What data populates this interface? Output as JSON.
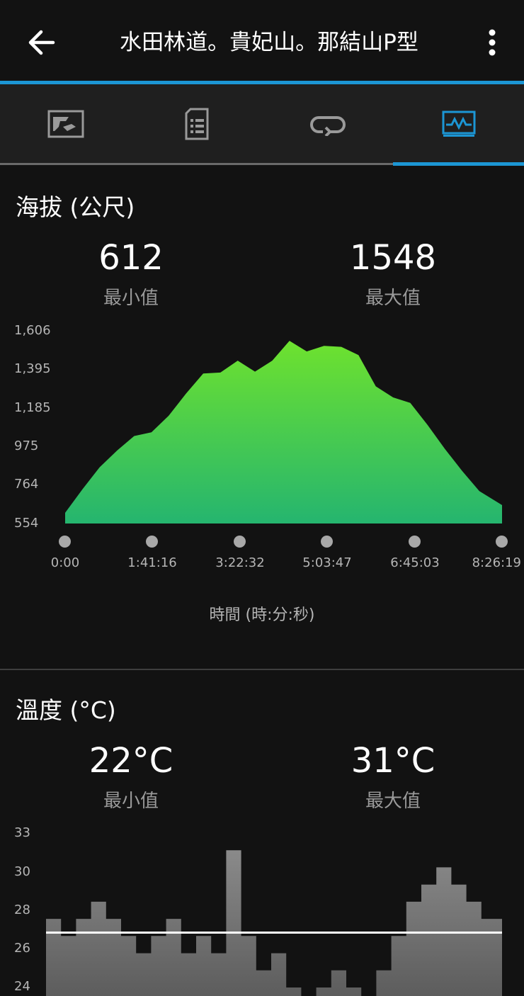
{
  "header": {
    "title": "水田林道。貴妃山。那結山P型"
  },
  "icons": {
    "back": "arrow-left-icon",
    "more": "more-vertical-icon",
    "tabs": [
      "map-icon",
      "details-icon",
      "laps-icon",
      "charts-icon"
    ]
  },
  "colors": {
    "accent": "#1c96d4",
    "elevation_top": "#6ee22e",
    "elevation_bottom": "#25b56f",
    "temperature_fill": "#7a7a7a"
  },
  "elevation": {
    "title": "海拔 (公尺)",
    "min_value": "612",
    "min_label": "最小值",
    "max_value": "1548",
    "max_label": "最大值",
    "x_axis_label": "時間 (時:分:秒)"
  },
  "temperature": {
    "title": "溫度 (°C)",
    "min_value": "22°C",
    "min_label": "最小值",
    "max_value": "31°C",
    "max_label": "最大值"
  },
  "chart_data": [
    {
      "type": "area",
      "name": "elevation",
      "x_unit": "seconds",
      "ylim": [
        554,
        1606
      ],
      "y_ticks": [
        "1,606",
        "1,395",
        "1,185",
        "975",
        "764",
        "554"
      ],
      "x_ticks": [
        "0:00",
        "1:41:16",
        "3:22:32",
        "5:03:47",
        "6:45:03",
        "8:26:19"
      ],
      "x": [
        0,
        1200,
        2400,
        3600,
        4800,
        6000,
        7200,
        8400,
        9600,
        10800,
        12000,
        13200,
        14400,
        15600,
        16800,
        18000,
        19200,
        20400,
        21600,
        22800,
        24000,
        25200,
        26400,
        27600,
        28800,
        30379
      ],
      "y": [
        612,
        740,
        860,
        950,
        1030,
        1050,
        1140,
        1260,
        1370,
        1375,
        1440,
        1380,
        1440,
        1548,
        1490,
        1520,
        1515,
        1470,
        1300,
        1240,
        1210,
        1090,
        960,
        840,
        730,
        654
      ]
    },
    {
      "type": "area",
      "name": "temperature",
      "ylim": [
        24,
        33
      ],
      "y_ticks": [
        "33",
        "30",
        "28",
        "26",
        "24"
      ],
      "x": [
        0,
        1000,
        2000,
        3000,
        4000,
        5000,
        6000,
        7000,
        8000,
        9000,
        10000,
        11000,
        12000,
        13000,
        14000,
        15000,
        16000,
        17000,
        18000,
        19000,
        20000,
        21000,
        22000,
        23000,
        24000,
        25000,
        26000,
        27000,
        28000,
        29000,
        30379
      ],
      "y": [
        28,
        27,
        28,
        29,
        28,
        27,
        26,
        27,
        28,
        26,
        27,
        26,
        32,
        27,
        25,
        26,
        24,
        23,
        24,
        25,
        24,
        23,
        25,
        27,
        29,
        30,
        31,
        30,
        29,
        28,
        28
      ]
    }
  ]
}
